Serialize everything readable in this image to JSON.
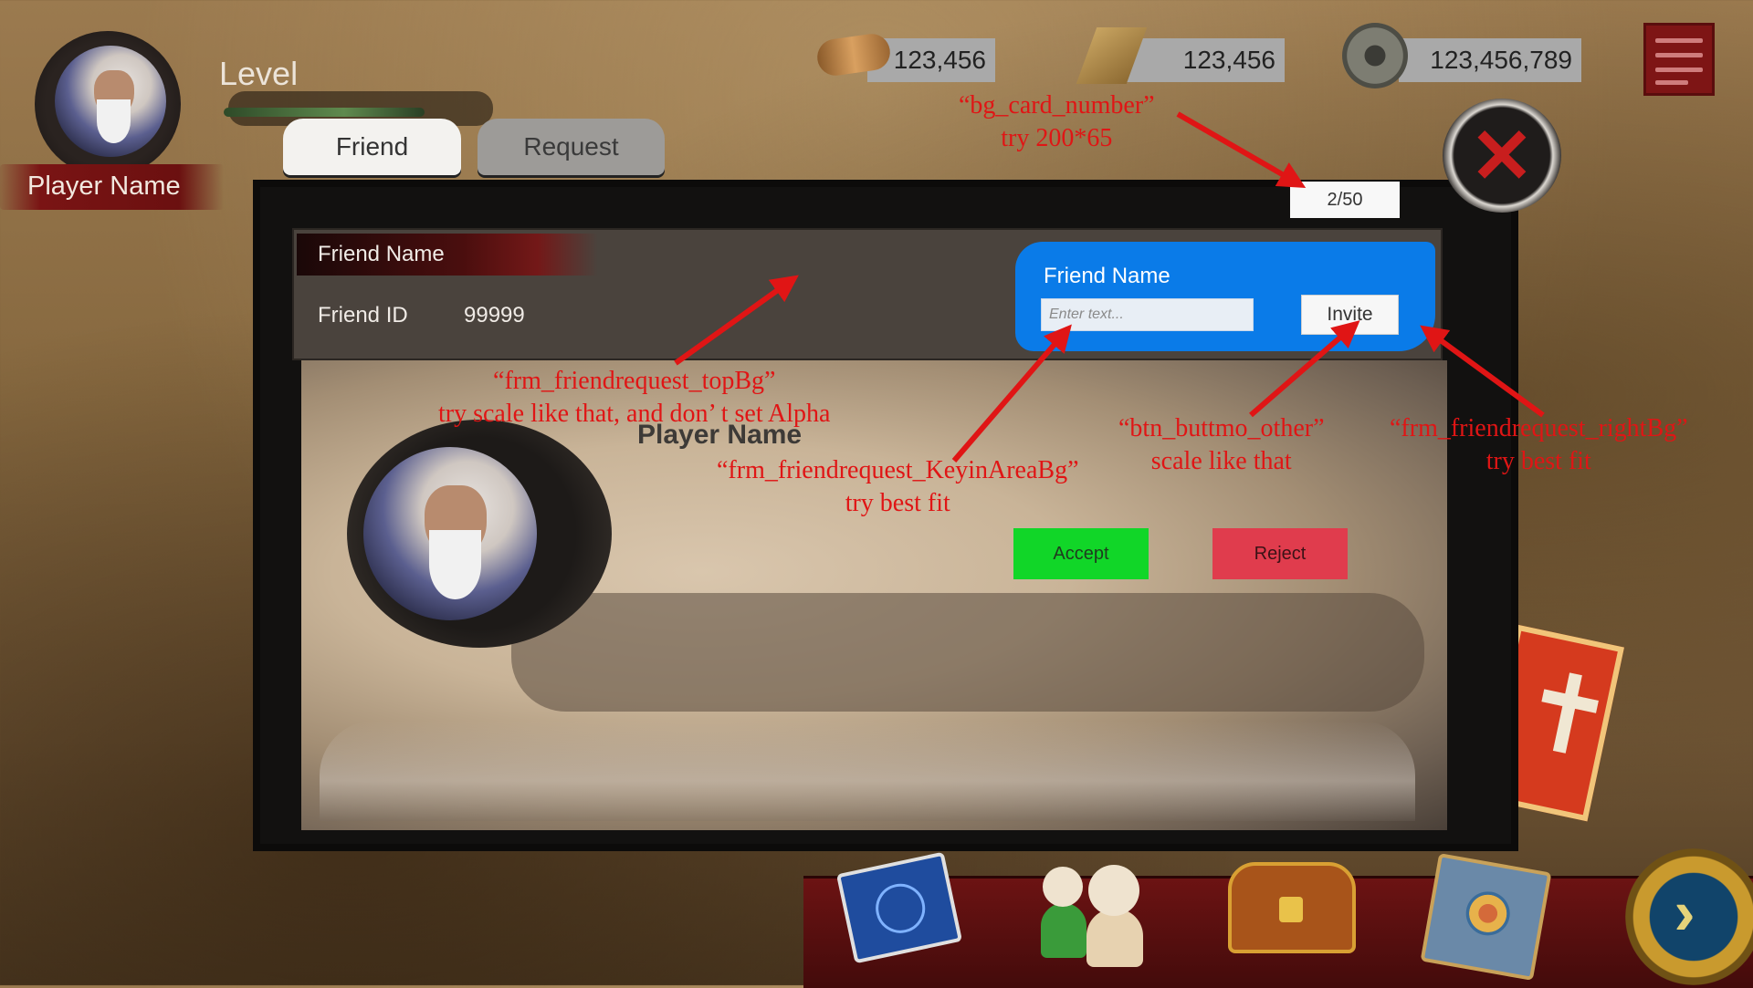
{
  "player": {
    "level_label": "Level",
    "name": "Player Name"
  },
  "tabs": [
    {
      "label": "Friend",
      "active": true
    },
    {
      "label": "Request",
      "active": false
    }
  ],
  "resources": [
    {
      "icon": "scroll-icon",
      "value": "123,456"
    },
    {
      "icon": "plank-icon",
      "value": "123,456"
    },
    {
      "icon": "coin-icon",
      "value": "123,456,789"
    }
  ],
  "counter": "2/50",
  "top_panel": {
    "friend_name_label": "Friend Name",
    "friend_id_label": "Friend ID",
    "friend_id_value": "99999"
  },
  "invite_panel": {
    "title": "Friend Name",
    "input_placeholder": "Enter text...",
    "input_value": "",
    "invite_label": "Invite"
  },
  "request_item": {
    "player_name": "Player Name",
    "accept_label": "Accept",
    "reject_label": "Reject"
  },
  "annotations": {
    "card_number": [
      "“bg_card_number”",
      "try 200*65"
    ],
    "top_bg": [
      "“frm_friendrequest_topBg”",
      "try scale like that, and don’ t set Alpha"
    ],
    "keyin": [
      "“frm_friendrequest_KeyinAreaBg”",
      "try best fit"
    ],
    "button_other": [
      "“btn_buttmo_other”",
      "scale like that"
    ],
    "right_bg": [
      "“frm_friendrequest_rightBg”",
      "try best fit"
    ]
  },
  "colors": {
    "accept": "#11d628",
    "reject": "#e03c4d",
    "invite_panel_bg": "#0a7be8",
    "annotation": "#e01515",
    "close_x": "#c81e1e"
  }
}
